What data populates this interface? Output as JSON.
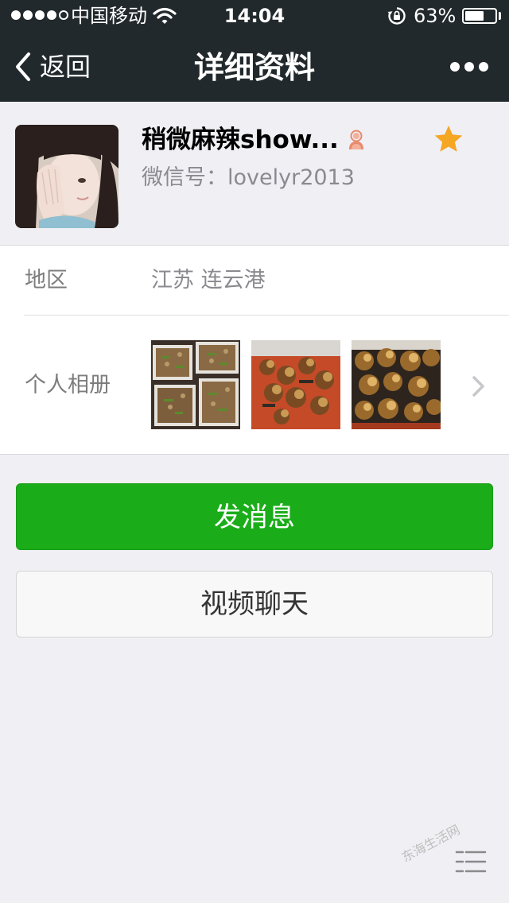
{
  "status_bar": {
    "carrier": "中国移动",
    "time": "14:04",
    "battery_percent": "63%",
    "battery_level": 0.63,
    "signal_bars_filled": 4,
    "signal_bars_total": 5,
    "icons": [
      "signal-dots-icon",
      "wifi-icon",
      "rotation-lock-icon",
      "battery-icon"
    ]
  },
  "nav": {
    "back_label": "返回",
    "title": "详细资料",
    "more_icon": "more-dots-icon"
  },
  "profile": {
    "name": "稍微麻辣show...",
    "wechat_id": "微信号：lovelyr2013",
    "gender_icon": "female-user-icon",
    "star_icon": "star-icon",
    "star_color": "#f5a623"
  },
  "details": {
    "region_label": "地区",
    "region_value": "江苏 连云港",
    "album_label": "个人相册",
    "album_chevron_icon": "chevron-right-icon"
  },
  "actions": {
    "send_message": "发消息",
    "video_chat": "视频聊天",
    "primary_color": "#1aad19"
  },
  "watermark": {
    "text": "东海生活网",
    "icon": "menu-lines-icon"
  }
}
